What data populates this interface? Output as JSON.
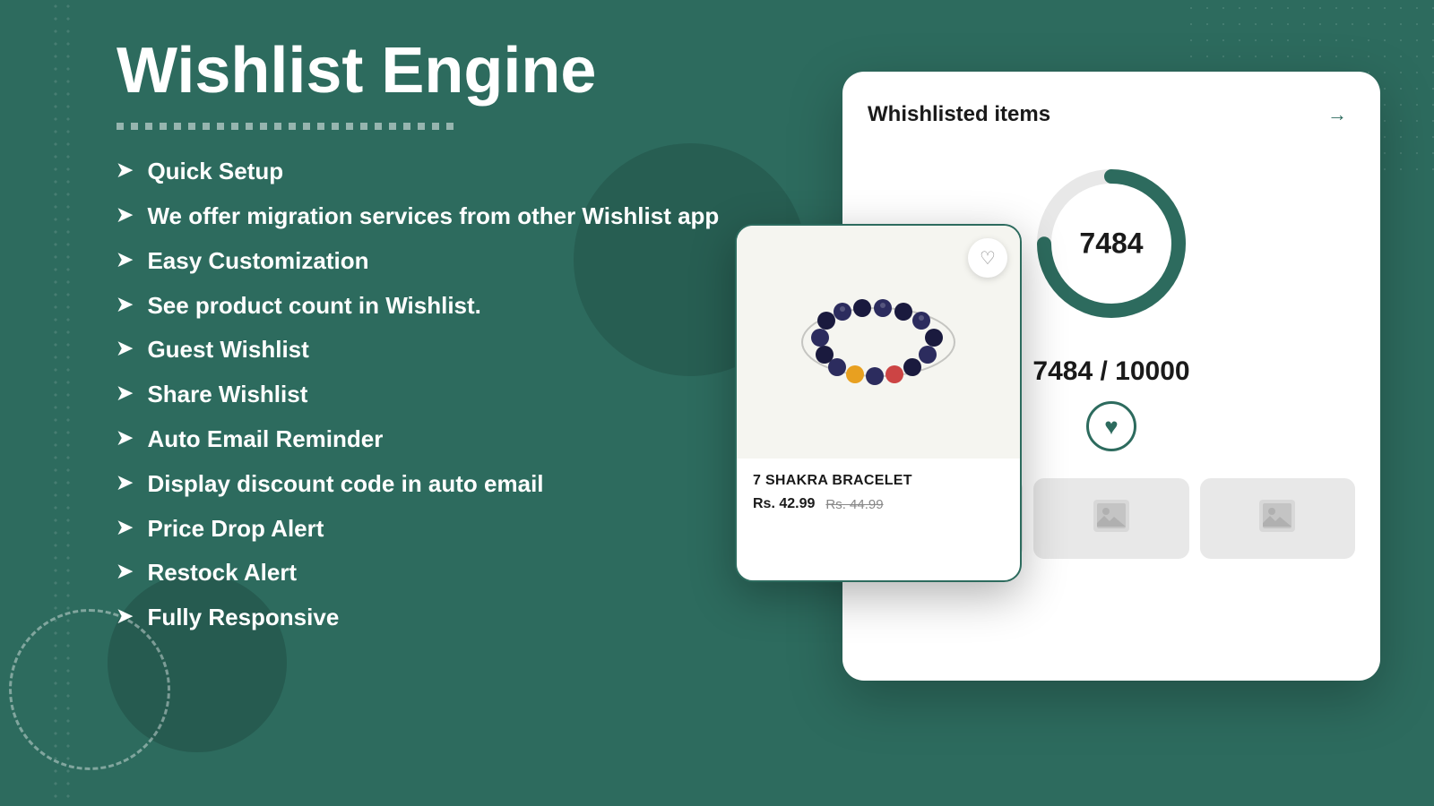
{
  "page": {
    "background_color": "#2d6b5e",
    "title": "Wishlist Engine"
  },
  "hero": {
    "title": "Wishlist Engine",
    "divider_label": "divider"
  },
  "features": [
    {
      "id": 1,
      "text": "Quick Setup"
    },
    {
      "id": 2,
      "text": "We offer migration services from other Wishlist app"
    },
    {
      "id": 3,
      "text": "Easy Customization"
    },
    {
      "id": 4,
      "text": "See product count in Wishlist."
    },
    {
      "id": 5,
      "text": "Guest Wishlist"
    },
    {
      "id": 6,
      "text": "Share Wishlist"
    },
    {
      "id": 7,
      "text": "Auto Email Reminder"
    },
    {
      "id": 8,
      "text": "Display discount code in auto email"
    },
    {
      "id": 9,
      "text": "Price Drop Alert"
    },
    {
      "id": 10,
      "text": "Restock Alert"
    },
    {
      "id": 11,
      "text": "Fully Responsive"
    }
  ],
  "wishlist_card": {
    "title": "Whishlisted items",
    "arrow_label": "→",
    "count": "7484",
    "total": "10000",
    "fraction_label": "7484 / 10000",
    "donut_pct": 74.84
  },
  "product_card": {
    "name": "7 SHAKRA BRACELET",
    "current_price": "Rs. 42.99",
    "original_price": "Rs. 44.99",
    "image_alt": "bracelet image"
  },
  "icons": {
    "heart_outline": "♡",
    "heart_filled": "♥",
    "arrow_right": "→",
    "chevron_right": "➤",
    "image_placeholder": "🖼"
  },
  "colors": {
    "brand_green": "#2d6b5e",
    "accent_teal": "#1e7a6a",
    "white": "#ffffff",
    "light_gray": "#e8e8e8",
    "dark_text": "#1a1a1a",
    "mid_gray": "#888888"
  }
}
